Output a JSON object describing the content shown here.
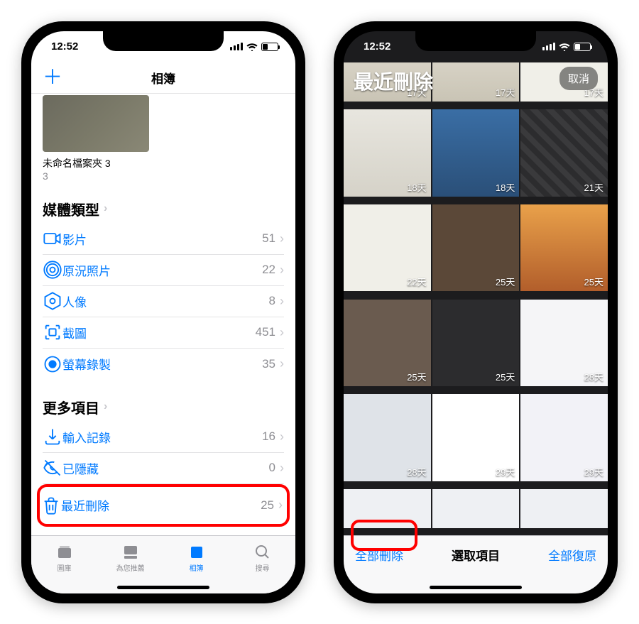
{
  "phone1": {
    "time": "12:52",
    "nav": {
      "title": "相簿",
      "plus": "＋"
    },
    "album": {
      "name": "未命名檔案夾 3",
      "count": "3"
    },
    "sections": {
      "media": {
        "title": "媒體類型",
        "rows": [
          {
            "icon": "video-icon",
            "label": "影片",
            "count": "51"
          },
          {
            "icon": "live-icon",
            "label": "原況照片",
            "count": "22"
          },
          {
            "icon": "portrait-icon",
            "label": "人像",
            "count": "8"
          },
          {
            "icon": "screenshot-icon",
            "label": "截圖",
            "count": "451"
          },
          {
            "icon": "record-icon",
            "label": "螢幕錄製",
            "count": "35"
          }
        ]
      },
      "more": {
        "title": "更多項目",
        "rows": [
          {
            "icon": "import-icon",
            "label": "輸入記錄",
            "count": "16"
          },
          {
            "icon": "hidden-icon",
            "label": "已隱藏",
            "count": "0"
          },
          {
            "icon": "trash-icon",
            "label": "最近刪除",
            "count": "25"
          }
        ]
      }
    },
    "tabs": [
      {
        "label": "圖庫"
      },
      {
        "label": "為您推薦"
      },
      {
        "label": "相簿"
      },
      {
        "label": "搜尋"
      }
    ]
  },
  "phone2": {
    "time": "12:52",
    "title": "最近刪除",
    "cancel": "取消",
    "days": [
      "17天",
      "17天",
      "17天",
      "18天",
      "18天",
      "21天",
      "22天",
      "25天",
      "25天",
      "25天",
      "25天",
      "28天",
      "28天",
      "29天",
      "29天"
    ],
    "toolbar": {
      "deleteAll": "全部刪除",
      "select": "選取項目",
      "recoverAll": "全部復原"
    }
  }
}
